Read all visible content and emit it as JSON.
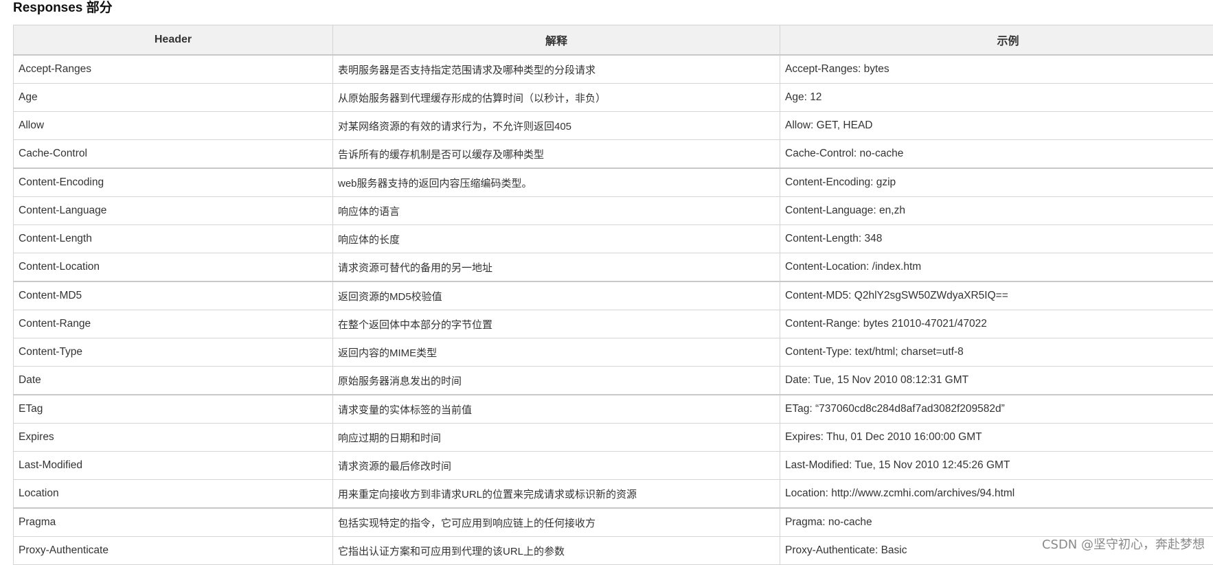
{
  "section_title": "Responses 部分",
  "table": {
    "headers": [
      "Header",
      "解释",
      "示例"
    ],
    "rows": [
      {
        "header": "Accept-Ranges",
        "desc": "表明服务器是否支持指定范围请求及哪种类型的分段请求",
        "example": "Accept-Ranges: bytes"
      },
      {
        "header": "Age",
        "desc": "从原始服务器到代理缓存形成的估算时间（以秒计，非负）",
        "example": "Age: 12"
      },
      {
        "header": "Allow",
        "desc": "对某网络资源的有效的请求行为，不允许则返回405",
        "example": "Allow: GET, HEAD"
      },
      {
        "header": "Cache-Control",
        "desc": "告诉所有的缓存机制是否可以缓存及哪种类型",
        "example": "Cache-Control: no-cache"
      },
      {
        "header": "Content-Encoding",
        "desc": "web服务器支持的返回内容压缩编码类型。",
        "example": "Content-Encoding: gzip"
      },
      {
        "header": "Content-Language",
        "desc": "响应体的语言",
        "example": "Content-Language: en,zh"
      },
      {
        "header": "Content-Length",
        "desc": "响应体的长度",
        "example": "Content-Length: 348"
      },
      {
        "header": "Content-Location",
        "desc": "请求资源可替代的备用的另一地址",
        "example": "Content-Location: /index.htm"
      },
      {
        "header": "Content-MD5",
        "desc": "返回资源的MD5校验值",
        "example": "Content-MD5: Q2hlY2sgSW50ZWdyaXR5IQ=="
      },
      {
        "header": "Content-Range",
        "desc": "在整个返回体中本部分的字节位置",
        "example": "Content-Range: bytes 21010-47021/47022"
      },
      {
        "header": "Content-Type",
        "desc": "返回内容的MIME类型",
        "example": "Content-Type: text/html; charset=utf-8"
      },
      {
        "header": "Date",
        "desc": "原始服务器消息发出的时间",
        "example": "Date: Tue, 15 Nov 2010 08:12:31 GMT"
      },
      {
        "header": "ETag",
        "desc": "请求变量的实体标签的当前值",
        "example": "ETag: “737060cd8c284d8af7ad3082f209582d”"
      },
      {
        "header": "Expires",
        "desc": "响应过期的日期和时间",
        "example": "Expires: Thu, 01 Dec 2010 16:00:00 GMT"
      },
      {
        "header": "Last-Modified",
        "desc": "请求资源的最后修改时间",
        "example": "Last-Modified: Tue, 15 Nov 2010 12:45:26 GMT"
      },
      {
        "header": "Location",
        "desc": "用来重定向接收方到非请求URL的位置来完成请求或标识新的资源",
        "example": "Location: http://www.zcmhi.com/archives/94.html"
      },
      {
        "header": "Pragma",
        "desc": "包括实现特定的指令，它可应用到响应链上的任何接收方",
        "example": "Pragma: no-cache"
      },
      {
        "header": "Proxy-Authenticate",
        "desc": "它指出认证方案和可应用到代理的该URL上的参数",
        "example": "Proxy-Authenticate: Basic"
      }
    ]
  },
  "watermark": "CSDN @坚守初心，奔赴梦想"
}
